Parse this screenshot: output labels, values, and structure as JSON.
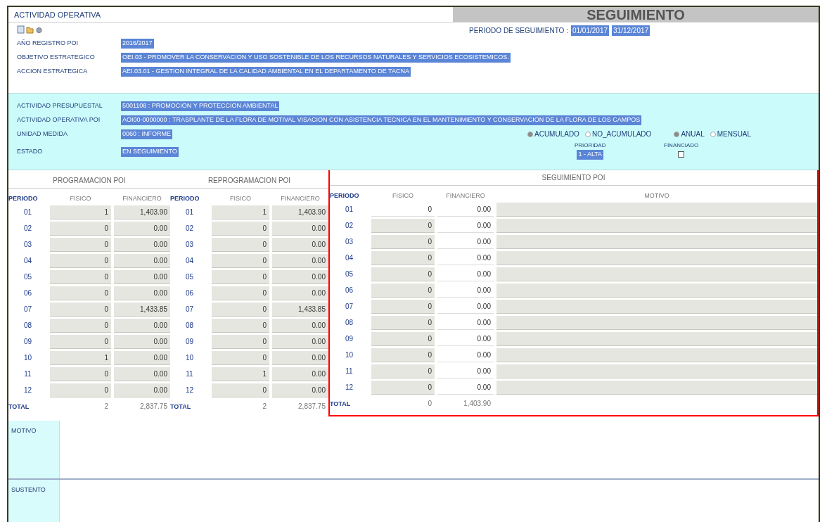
{
  "header": {
    "title": "ACTIVIDAD OPERATIVA",
    "section": "SEGUIMIENTO"
  },
  "period": {
    "label": "PERIODO DE SEGUIMIENTO :",
    "start": "01/01/2017",
    "end": "31/12/2017"
  },
  "general_fields": [
    {
      "label": "AÑO REGISTRO POI",
      "value": "2016/2017"
    },
    {
      "label": "OBJETIVO ESTRATEGICO",
      "value": "OEI.03 - PROMOVER LA CONSERVACION Y USO SOSTENIBLE DE LOS RECURSOS NATURALES Y SERVICIOS ECOSISTEMICOS."
    },
    {
      "label": "ACCION ESTRATEGICA",
      "value": "AEI.03.01 - GESTION INTEGRAL DE LA CALIDAD AMBIENTAL EN EL DEPARTAMENTO DE TACNA"
    }
  ],
  "activity_fields": [
    {
      "label": "ACTIVIDAD PRESUPUESTAL",
      "value": "5001108 : PROMOCION Y PROTECCION AMBIENTAL"
    },
    {
      "label": "ACTIVIDAD OPERATIVA POI",
      "value": "AOI00-0000000 : TRASPLANTE DE LA FLORA DE MOTIVAL VISACION CON ASISTENCIA TECNICA EN EL MANTENIMIENTO Y CONSERVACION DE LA FLORA DE LOS CAMPOS"
    },
    {
      "label": "UNIDAD MEDIDA",
      "value": "0060 : INFORME"
    },
    {
      "label": "ESTADO",
      "value": "EN SEGUIMIENTO"
    }
  ],
  "radio_groups": [
    [
      {
        "label": "ACUMULADO",
        "selected": true
      },
      {
        "label": "NO_ACUMULADO",
        "selected": false
      }
    ],
    [
      {
        "label": "ANUAL",
        "selected": true
      },
      {
        "label": "MENSUAL",
        "selected": false
      }
    ]
  ],
  "priority": {
    "label": "PRIORIDAD",
    "value": "1 - ALTA"
  },
  "financed": {
    "label": "FINANCIADO",
    "checked": false
  },
  "tables": [
    {
      "title": "PROGRAMACION POI",
      "columns": [
        "PERIODO",
        "FISICO",
        "FINANCIERO"
      ],
      "rows": [
        {
          "periodo": "01",
          "fisico": "1",
          "financiero": "1,403.90"
        },
        {
          "periodo": "02",
          "fisico": "0",
          "financiero": "0.00"
        },
        {
          "periodo": "03",
          "fisico": "0",
          "financiero": "0.00"
        },
        {
          "periodo": "04",
          "fisico": "0",
          "financiero": "0.00"
        },
        {
          "periodo": "05",
          "fisico": "0",
          "financiero": "0.00"
        },
        {
          "periodo": "06",
          "fisico": "0",
          "financiero": "0.00"
        },
        {
          "periodo": "07",
          "fisico": "0",
          "financiero": "1,433.85"
        },
        {
          "periodo": "08",
          "fisico": "0",
          "financiero": "0.00"
        },
        {
          "periodo": "09",
          "fisico": "0",
          "financiero": "0.00"
        },
        {
          "periodo": "10",
          "fisico": "1",
          "financiero": "0.00"
        },
        {
          "periodo": "11",
          "fisico": "0",
          "financiero": "0.00"
        },
        {
          "periodo": "12",
          "fisico": "0",
          "financiero": "0.00"
        }
      ],
      "total": {
        "label": "TOTAL",
        "fisico": "2",
        "financiero": "2,837.75"
      }
    },
    {
      "title": "REPROGRAMACION POI",
      "columns": [
        "PERIODO",
        "FISICO",
        "FINANCIERO"
      ],
      "rows": [
        {
          "periodo": "01",
          "fisico": "1",
          "financiero": "1,403.90"
        },
        {
          "periodo": "02",
          "fisico": "0",
          "financiero": "0.00"
        },
        {
          "periodo": "03",
          "fisico": "0",
          "financiero": "0.00"
        },
        {
          "periodo": "04",
          "fisico": "0",
          "financiero": "0.00"
        },
        {
          "periodo": "05",
          "fisico": "0",
          "financiero": "0.00"
        },
        {
          "periodo": "06",
          "fisico": "0",
          "financiero": "0.00"
        },
        {
          "periodo": "07",
          "fisico": "0",
          "financiero": "1,433.85"
        },
        {
          "periodo": "08",
          "fisico": "0",
          "financiero": "0.00"
        },
        {
          "periodo": "09",
          "fisico": "0",
          "financiero": "0.00"
        },
        {
          "periodo": "10",
          "fisico": "0",
          "financiero": "0.00"
        },
        {
          "periodo": "11",
          "fisico": "1",
          "financiero": "0.00"
        },
        {
          "periodo": "12",
          "fisico": "0",
          "financiero": "0.00"
        }
      ],
      "total": {
        "label": "TOTAL",
        "fisico": "2",
        "financiero": "2,837.75"
      }
    }
  ],
  "tracking": {
    "title": "SEGUIMIENTO POI",
    "columns": [
      "PERIODO",
      "FISICO",
      "FINANCIERO",
      "MOTIVO"
    ],
    "rows": [
      {
        "periodo": "01",
        "fisico": "0",
        "financiero": "0.00",
        "editable": true
      },
      {
        "periodo": "02",
        "fisico": "0",
        "financiero": "0.00",
        "editable": false
      },
      {
        "periodo": "03",
        "fisico": "0",
        "financiero": "0.00",
        "editable": false
      },
      {
        "periodo": "04",
        "fisico": "0",
        "financiero": "0.00",
        "editable": false
      },
      {
        "periodo": "05",
        "fisico": "0",
        "financiero": "0.00",
        "editable": false
      },
      {
        "periodo": "06",
        "fisico": "0",
        "financiero": "0.00",
        "editable": false
      },
      {
        "periodo": "07",
        "fisico": "0",
        "financiero": "0.00",
        "editable": false
      },
      {
        "periodo": "08",
        "fisico": "0",
        "financiero": "0.00",
        "editable": false
      },
      {
        "periodo": "09",
        "fisico": "0",
        "financiero": "0.00",
        "editable": false
      },
      {
        "periodo": "10",
        "fisico": "0",
        "financiero": "0.00",
        "editable": false
      },
      {
        "periodo": "11",
        "fisico": "0",
        "financiero": "0.00",
        "editable": false
      },
      {
        "periodo": "12",
        "fisico": "0",
        "financiero": "0.00",
        "editable": false
      }
    ],
    "total": {
      "label": "TOTAL",
      "fisico": "0",
      "financiero": "1,403.90"
    }
  },
  "notes": [
    {
      "label": "MOTIVO"
    },
    {
      "label": "SUSTENTO"
    }
  ]
}
